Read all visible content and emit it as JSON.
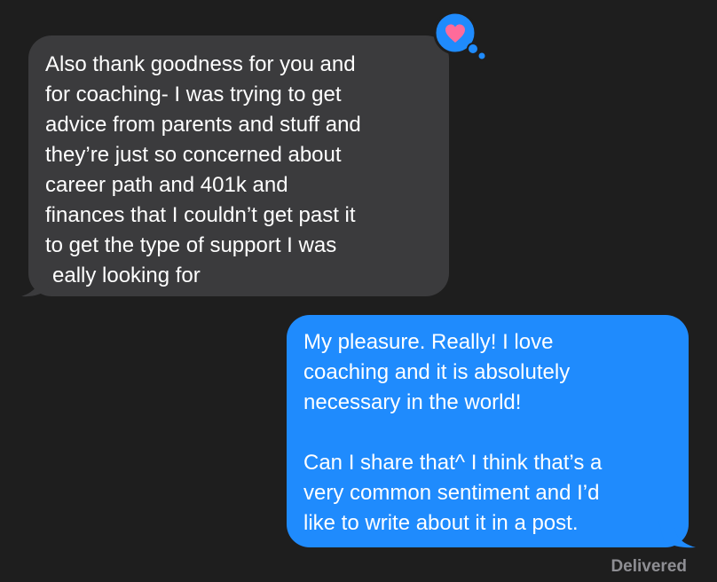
{
  "conversation": {
    "incoming": {
      "lines": [
        "Also thank goodness for you and",
        "for coaching- I was trying to get",
        "advice from parents and stuff and",
        "they’re just so concerned about",
        "career path and 401k and",
        "finances that I couldn’t get past it",
        "to get the type of support I was",
        "really looking for"
      ],
      "reaction": "heart-icon"
    },
    "outgoing": {
      "lines": [
        "My pleasure. Really! I love",
        "coaching and it is absolutely",
        "necessary in the world!",
        "",
        "Can I share that^ I think that’s a",
        "very common sentiment and I’d",
        "like to write about it in a post."
      ]
    },
    "status": "Delivered"
  },
  "colors": {
    "background": "#1e1e1e",
    "incoming_bubble": "#3b3b3d",
    "outgoing_bubble": "#1f8bfd",
    "heart": "#ff6b9a",
    "status_text": "#8e8e93"
  }
}
